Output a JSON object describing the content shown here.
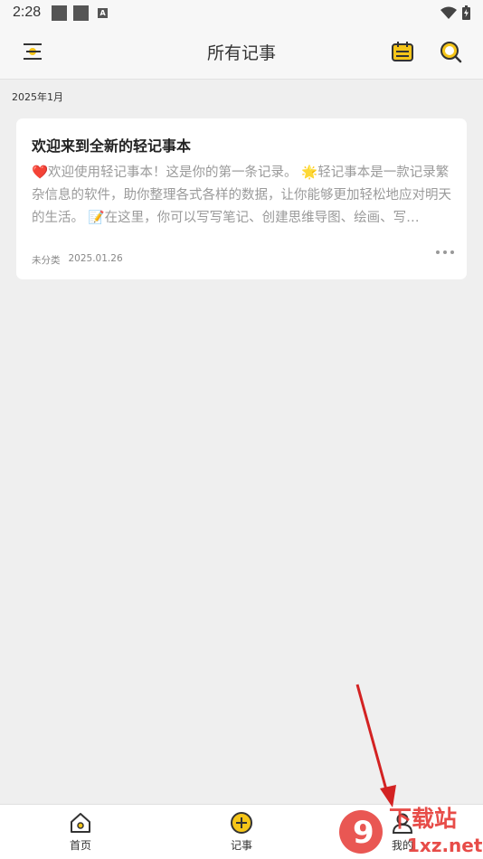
{
  "status_bar": {
    "time": "2:28",
    "notification_badge": "A"
  },
  "app_bar": {
    "title": "所有记事",
    "menu_icon": "menu-icon",
    "calendar_icon": "calendar-icon",
    "search_icon": "search-icon"
  },
  "list": {
    "month_label": "2025年1月",
    "notes": [
      {
        "title": "欢迎来到全新的轻记事本",
        "body": "❤️欢迎使用轻记事本！这是你的第一条记录。 🌟轻记事本是一款记录繁杂信息的软件，助你整理各式各样的数据，让你能够更加轻松地应对明天的生活。 📝在这里，你可以写写笔记、创建思维导图、绘画、写…",
        "category": "未分类",
        "date": "2025.01.26"
      }
    ]
  },
  "tab_bar": {
    "tabs": [
      {
        "label": "首页",
        "icon": "home-icon"
      },
      {
        "label": "记事",
        "icon": "add-circle-icon"
      },
      {
        "label": "我的",
        "icon": "profile-icon"
      }
    ]
  },
  "watermark": {
    "logo_text": "9 下载站",
    "domain": "1xz.net"
  },
  "colors": {
    "accent": "#f5c518",
    "annotation_arrow": "#d32222",
    "background": "#efefef"
  }
}
